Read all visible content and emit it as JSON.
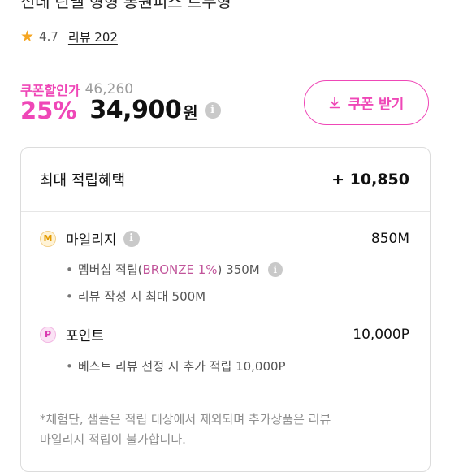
{
  "product": {
    "title_partial": "신데 린넬 형형 롱원피스 트무형",
    "rating": "4.7",
    "review_text": "리뷰 202"
  },
  "price": {
    "coupon_label": "쿠폰할인가",
    "original_price": "46,260",
    "discount_rate": "25%",
    "sale_price": "34,900",
    "unit": "원"
  },
  "coupon_button": {
    "label": "쿠폰 받기"
  },
  "benefits": {
    "header_label": "최대 적립혜택",
    "header_value": "+ 10,850",
    "mileage": {
      "badge": "M",
      "label": "마일리지",
      "value": "850M",
      "sub_items": [
        {
          "prefix": "멤버십 적립(",
          "tier": "BRONZE 1%",
          "suffix": ") 350M"
        },
        {
          "text": "리뷰 작성 시 최대 500M"
        }
      ]
    },
    "point": {
      "badge": "P",
      "label": "포인트",
      "value": "10,000P",
      "sub_items": [
        {
          "text": "베스트 리뷰 선정 시 추가 적립 10,000P"
        }
      ]
    },
    "notice_line1": "*체험단, 샘플은 적립 대상에서 제외되며 추가상품은 리뷰",
    "notice_line2": "마일리지 적립이 불가합니다."
  },
  "icons": {
    "star": "star-icon",
    "info": "info-icon",
    "download": "download-icon"
  },
  "colors": {
    "accent": "#ef47b7",
    "star": "#f5a623",
    "tier_text": "#c1549a",
    "muted": "#8e8e8e"
  }
}
